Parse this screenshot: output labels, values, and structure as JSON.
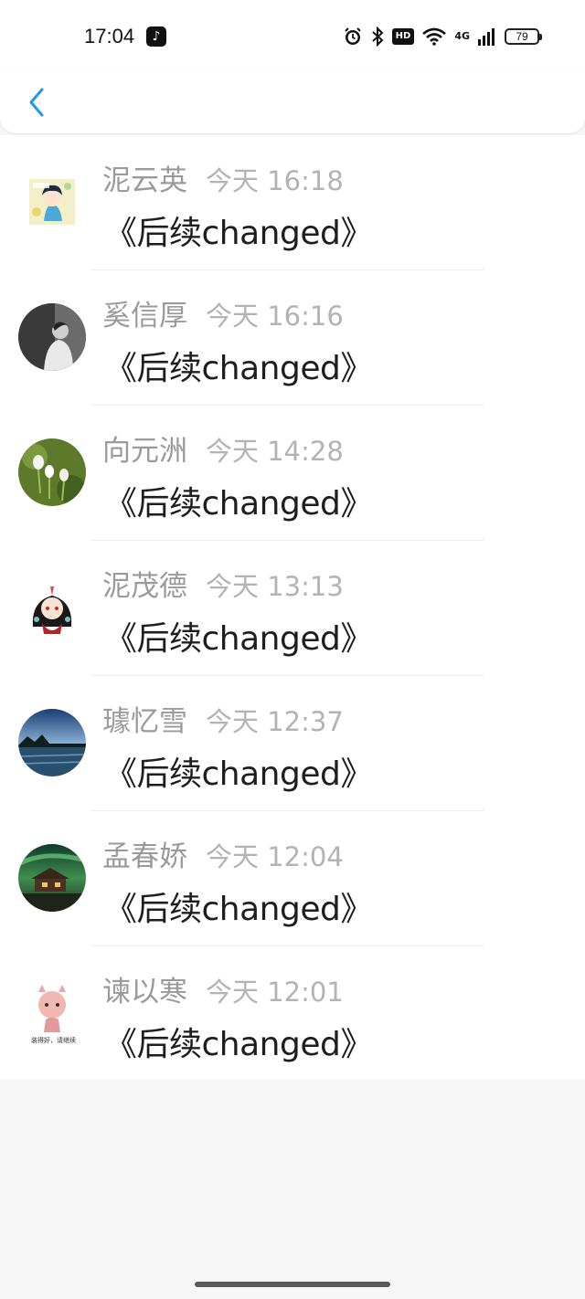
{
  "status_bar": {
    "time": "17:04",
    "battery": "79",
    "hd": "HD",
    "network": "4G"
  },
  "nav": {
    "back_icon": "chevron-left-icon",
    "accent_color": "#2196f3"
  },
  "messages": [
    {
      "name": "泥云英",
      "time": "今天 16:18",
      "text": "《后续changed》",
      "avatar": "anime-boy-sticker"
    },
    {
      "name": "奚信厚",
      "time": "今天 16:16",
      "text": "《后续changed》",
      "avatar": "bw-portrait"
    },
    {
      "name": "向元洲",
      "time": "今天 14:28",
      "text": "《后续changed》",
      "avatar": "snowdrop-flowers"
    },
    {
      "name": "泥茂德",
      "time": "今天 13:13",
      "text": "《后续changed》",
      "avatar": "anime-girl-red"
    },
    {
      "name": "璩忆雪",
      "time": "今天 12:37",
      "text": "《后续changed》",
      "avatar": "lake-landscape"
    },
    {
      "name": "孟春娇",
      "time": "今天 12:04",
      "text": "《后续changed》",
      "avatar": "aurora-house"
    },
    {
      "name": "谏以寒",
      "time": "今天 12:01",
      "text": "《后续changed》",
      "avatar": "cartoon-pig-girl",
      "avatar_caption": "装得好，请继续"
    }
  ]
}
